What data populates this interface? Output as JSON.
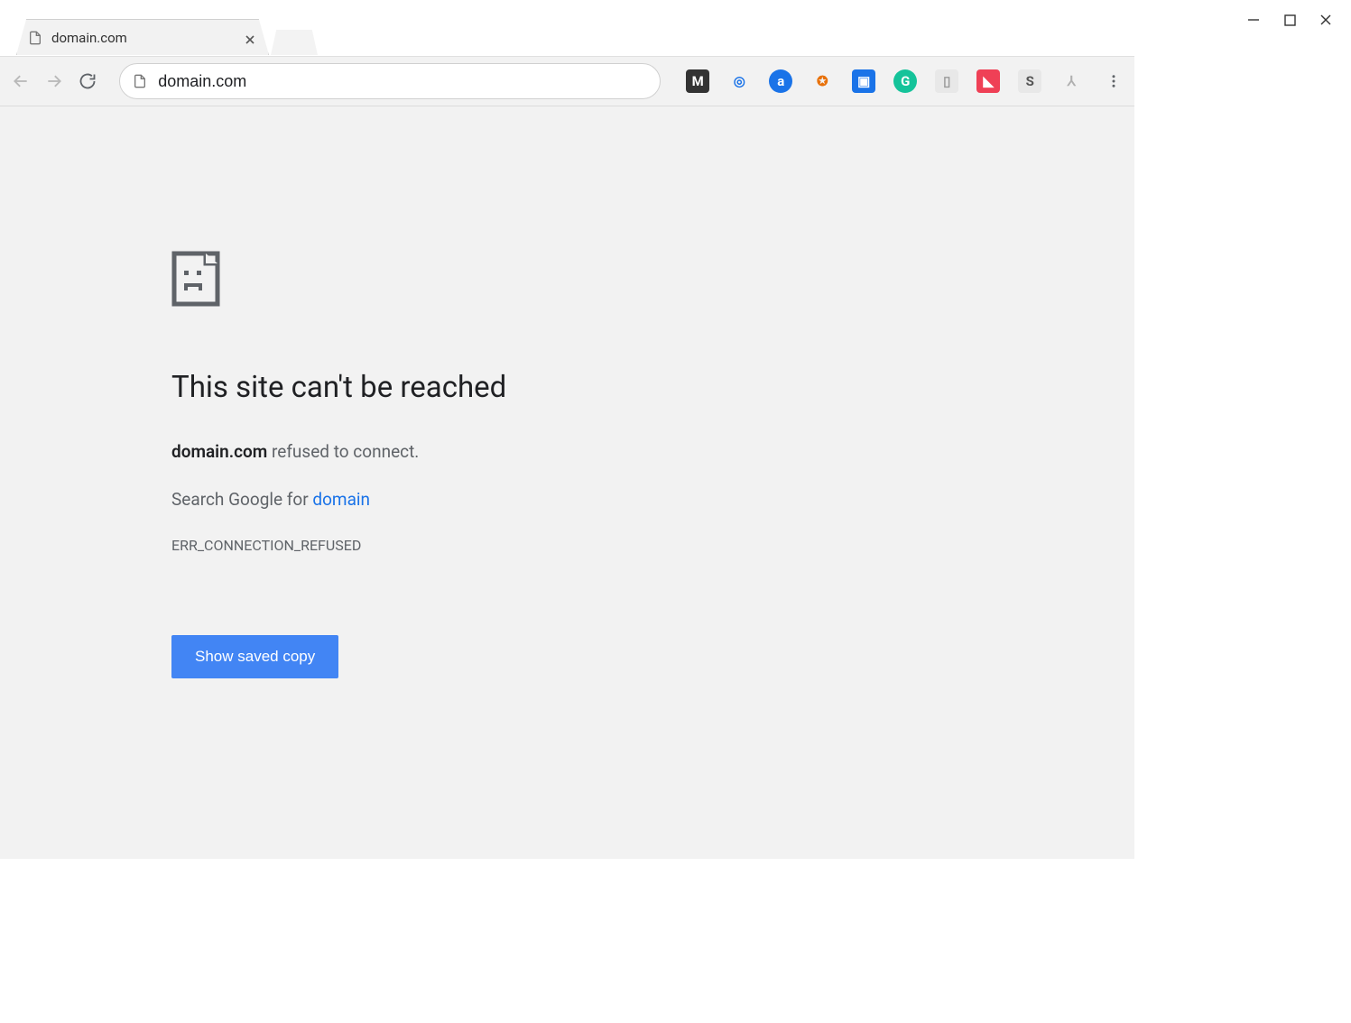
{
  "window": {
    "minimize": "–",
    "maximize": "☐",
    "close": "✕"
  },
  "tab": {
    "title": "domain.com"
  },
  "toolbar": {
    "url": "domain.com"
  },
  "extensions": [
    {
      "name": "megasync-icon",
      "bg": "#333333",
      "fg": "#ffffff",
      "glyph": "M"
    },
    {
      "name": "circle-q-icon",
      "bg": "transparent",
      "fg": "#1a73e8",
      "glyph": "◎"
    },
    {
      "name": "amazon-icon",
      "bg": "#1a73e8",
      "fg": "#ffffff",
      "glyph": "a",
      "round": true
    },
    {
      "name": "bitly-icon",
      "bg": "transparent",
      "fg": "#e8710a",
      "glyph": "✪"
    },
    {
      "name": "screenshot-icon",
      "bg": "#1a73e8",
      "fg": "#ffffff",
      "glyph": "▣"
    },
    {
      "name": "grammarly-icon",
      "bg": "#15c39a",
      "fg": "#ffffff",
      "glyph": "G",
      "round": true
    },
    {
      "name": "doc-icon",
      "bg": "#e8e8e8",
      "fg": "#999999",
      "glyph": "▯"
    },
    {
      "name": "pocket-icon",
      "bg": "#ef4056",
      "fg": "#ffffff",
      "glyph": "◣"
    },
    {
      "name": "s-icon",
      "bg": "#e8e8e8",
      "fg": "#555555",
      "glyph": "S"
    },
    {
      "name": "wishbone-icon",
      "bg": "transparent",
      "fg": "#b0b0b0",
      "glyph": "⅄"
    }
  ],
  "error": {
    "title": "This site can't be reached",
    "host": "domain.com",
    "refused_text": " refused to connect.",
    "search_prefix": "Search Google for ",
    "search_term": "domain",
    "error_code": "ERR_CONNECTION_REFUSED",
    "button_label": "Show saved copy"
  }
}
